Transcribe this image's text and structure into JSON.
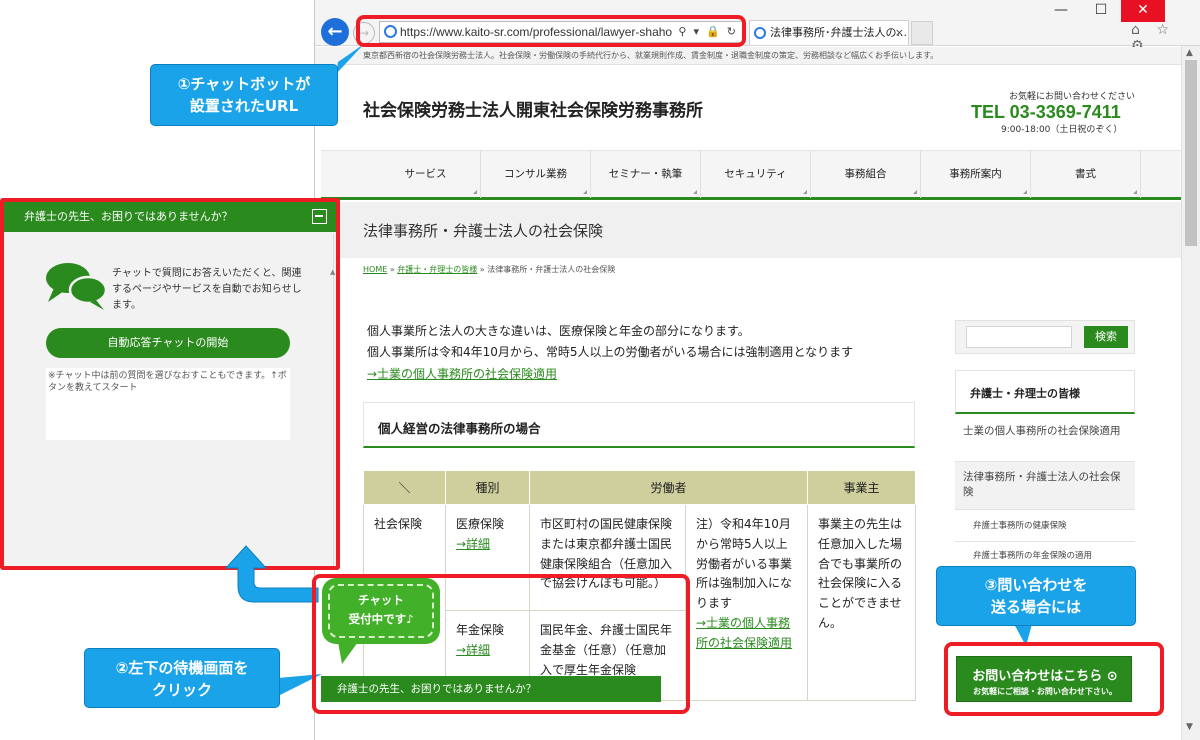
{
  "browser": {
    "url": "https://www.kaito-sr.com/professional/lawyer-shaho",
    "tab_title": "法律事務所･弁護士法人の...",
    "tab_close": "×",
    "window_controls": [
      "—",
      "☐",
      "✕"
    ],
    "toolbar_icons": "⌂ ☆ ⚙"
  },
  "site": {
    "tagline": "東京都西新宿の社会保険労務士法人。社会保険・労働保険の手続代行から、就業規則作成、賃金制度・退職金制度の策定、労務相談など幅広くお手伝いします。",
    "title": "社会保険労務士法人開東社会保険労務事務所",
    "contact_label": "お気軽にお問い合わせください",
    "tel": "TEL 03-3369-7411",
    "hours": "9:00-18:00（土日祝のぞく）",
    "nav": [
      "サービス",
      "コンサル業務",
      "セミナー・執筆",
      "セキュリティ",
      "事務組合",
      "事務所案内",
      "書式"
    ],
    "page_heading": "法律事務所・弁護士法人の社会保険",
    "breadcrumb": {
      "home": "HOME",
      "sep": " » ",
      "parent": "弁護士・弁理士の皆様",
      "current": "法律事務所・弁護士法人の社会保険"
    },
    "intro1": "個人事業所と法人の大きな違いは、医療保険と年金の部分になります。",
    "intro2": "個人事業所は令和4年10月から、常時5人以上の労働者がいる場合には強制適用となります",
    "intro_link": "→士業の個人事務所の社会保険適用",
    "section_title": "個人経営の法律事務所の場合",
    "table": {
      "headers": [
        "＼",
        "種別",
        "労働者",
        "事業主"
      ],
      "row1": {
        "c0": "社会保険",
        "c1": "医療保険",
        "c1_link": "→詳細",
        "c2": "市区町村の国民健康保険または東京都弁護士国民健康保険組合（任意加入で協会けんぽも可能。）",
        "c3": "注）令和4年10月から常時5人以上労働者がいる事業所は強制加入になります",
        "c3_link": "→士業の個人事務所の社会保険適用",
        "c4": "事業主の先生は任意加入した場合でも事業所の社会保険に入ることができません。"
      },
      "row2": {
        "c1": "年金保険",
        "c1_link": "→詳細",
        "c2": "国民年金、弁護士国民年金基金（任意）（任意加入で厚生年金保険"
      }
    },
    "search_button": "検索",
    "sidebar_heading": "弁護士・弁理士の皆様",
    "sidebar_items": [
      "士業の個人事務所の社会保険適用",
      "法律事務所・弁護士法人の社会保険",
      "弁護士事務所の健康保険",
      "弁護士事務所の年金保険の適用"
    ],
    "cta_main": "お問い合わせはこちら ⊙",
    "cta_sub": "お気軽にご相談・お問い合わせ下さい。",
    "chat_bar": "弁護士の先生、お困りではありませんか？"
  },
  "chat_widget": {
    "header": "弁護士の先生、お困りではありませんか？",
    "intro": "チャットで質問にお答えいただくと、関連するページやサービスを自動でお知らせします。",
    "start_button": "自動応答チャットの開始",
    "note": "※チャット中は前の質問を選びなおすこともできます。↑ボタンを教えてスタート"
  },
  "annotations": {
    "callout1": "①チャットボットが\n設置されたURL",
    "callout2": "②左下の待機画面を\nクリック",
    "callout3": "③問い合わせを\n送る場合には",
    "bubble": "チャット\n受付中です♪"
  },
  "colors": {
    "brand_green": "#2a8a1e",
    "callout_blue": "#1aa3e8",
    "highlight_red": "#ee1c25"
  }
}
